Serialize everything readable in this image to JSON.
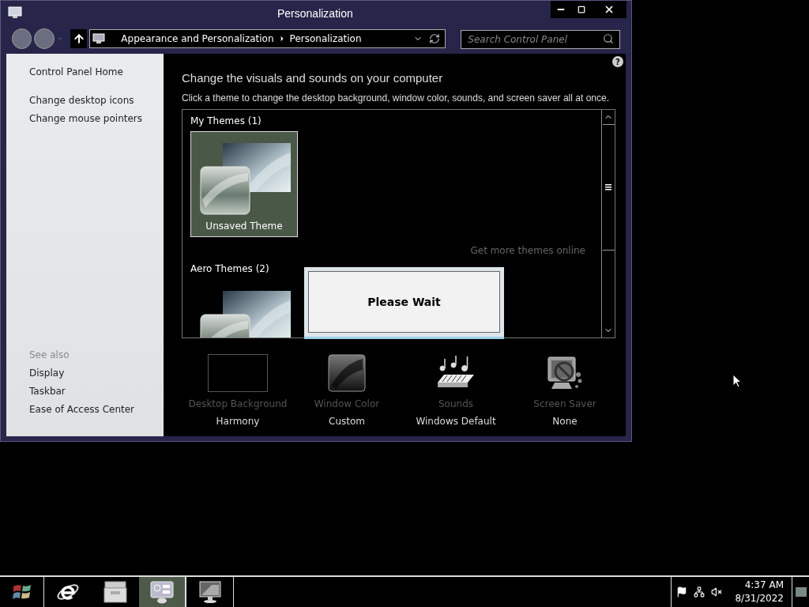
{
  "window": {
    "title": "Personalization"
  },
  "address": {
    "breadcrumb": [
      "Appearance and Personalization",
      "Personalization"
    ]
  },
  "search": {
    "placeholder": "Search Control Panel"
  },
  "help": {
    "label": "?"
  },
  "sidebar": {
    "links": [
      "Control Panel Home",
      "Change desktop icons",
      "Change mouse pointers"
    ],
    "see_also_heading": "See also",
    "see_also": [
      "Display",
      "Taskbar",
      "Ease of Access Center"
    ]
  },
  "main": {
    "heading": "Change the visuals and sounds on your computer",
    "description": "Click a theme to change the desktop background, window color, sounds, and screen saver all at once."
  },
  "themes": {
    "groups": [
      {
        "title": "My Themes (1)",
        "items": [
          {
            "label": "Unsaved Theme",
            "selected": true
          }
        ]
      },
      {
        "title": "Aero Themes (2)",
        "items": [
          {
            "selected": false
          }
        ]
      }
    ],
    "get_more_link": "Get more themes online"
  },
  "dialog": {
    "message": "Please Wait"
  },
  "settings": [
    {
      "kind": "background",
      "label": "Desktop Background",
      "value": "Harmony"
    },
    {
      "kind": "color",
      "label": "Window Color",
      "value": "Custom"
    },
    {
      "kind": "sounds",
      "label": "Sounds",
      "value": "Windows Default"
    },
    {
      "kind": "screensaver",
      "label": "Screen Saver",
      "value": "None"
    }
  ],
  "taskbar": {
    "items": [
      {
        "kind": "browser",
        "selected": false
      },
      {
        "kind": "files",
        "selected": false
      },
      {
        "kind": "control-panel",
        "selected": true
      },
      {
        "kind": "display",
        "selected": false
      }
    ],
    "time": "4:37 AM",
    "date": "8/31/2022"
  }
}
